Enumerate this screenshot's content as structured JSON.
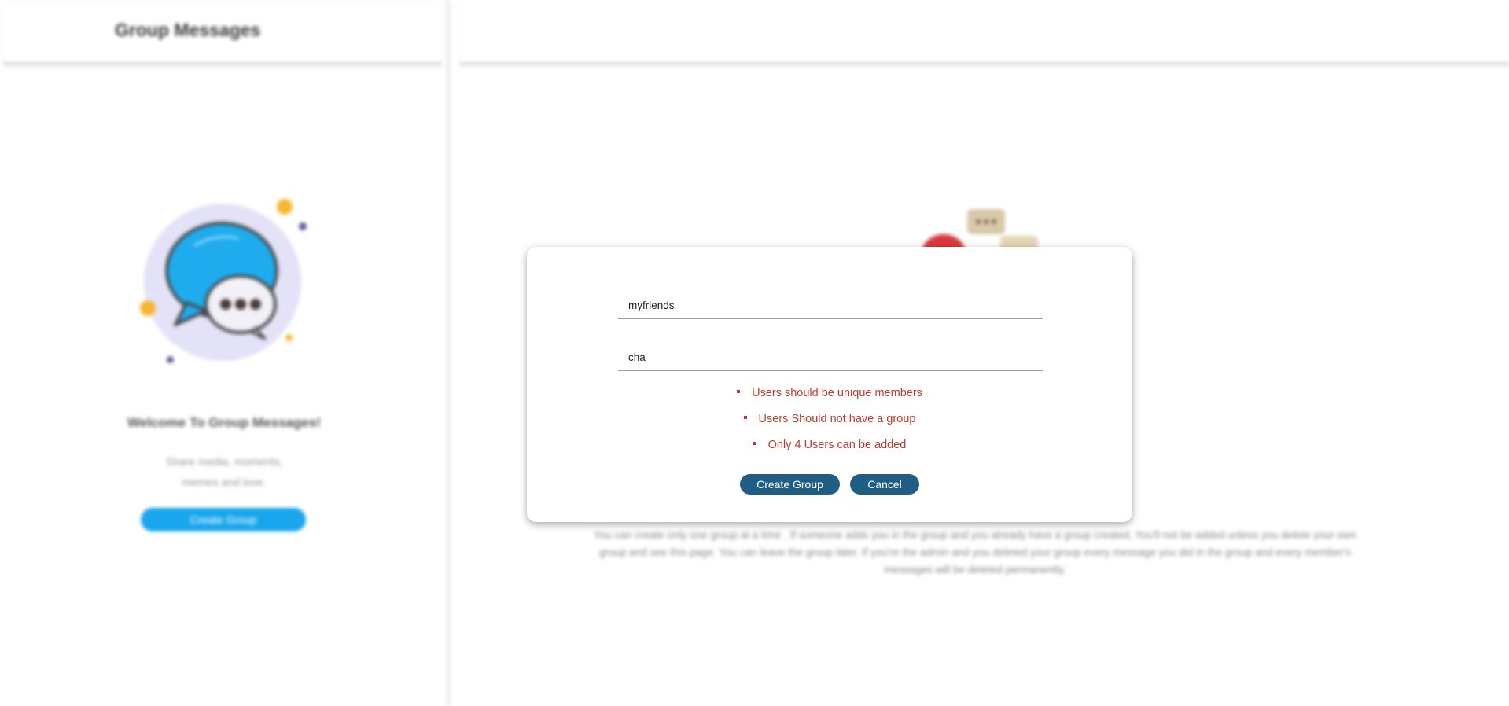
{
  "sidebar": {
    "title": "Group Messages",
    "welcome": "Welcome To Group Messages!",
    "tagline_line1": "Share media, moments,",
    "tagline_line2": "memes and love.",
    "create_button": "Create Group"
  },
  "main": {
    "info_text": "You can create only one group at a time . If someone adds you in the group and you already have a group created, You'll not be added unless you delete your own group and see this page. You can leave the group later. If you're the admin and you deleted your group every message you did in the group and every member's messages will be deleted permanently."
  },
  "modal": {
    "group_name_value": "myfriends",
    "users_value": "cha",
    "errors": [
      "Users should be unique members",
      "Users Should not have a group",
      "Only 4 Users can be added"
    ],
    "create_button": "Create Group",
    "cancel_button": "Cancel"
  },
  "colors": {
    "accent": "#1f5d84",
    "error": "#c0392b",
    "sidebar_button": "#1aa6ec"
  }
}
